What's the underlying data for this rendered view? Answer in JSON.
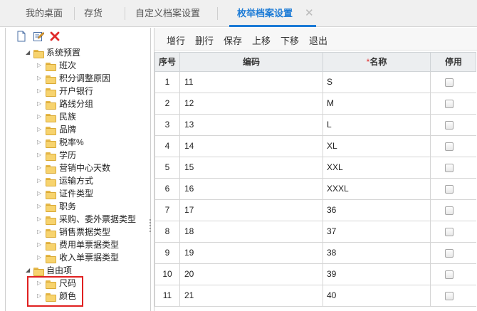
{
  "tabs": [
    {
      "label": "我的桌面",
      "active": false
    },
    {
      "label": "存货",
      "active": false
    },
    {
      "label": "自定义档案设置",
      "active": false
    },
    {
      "label": "枚举档案设置",
      "active": true
    }
  ],
  "left_toolbar": {
    "icons": [
      "new-document-icon",
      "edit-icon",
      "delete-icon"
    ]
  },
  "tree": {
    "system_root": "系统预置",
    "system_items": [
      "班次",
      "积分调整原因",
      "开户银行",
      "路线分组",
      "民族",
      "品牌",
      "税率%",
      "学历",
      "营销中心天数",
      "运输方式",
      "证件类型",
      "职务",
      "采购、委外票据类型",
      "销售票据类型",
      "费用单票据类型",
      "收入单票据类型"
    ],
    "custom_root": "自由项",
    "custom_items": [
      "尺码",
      "颜色"
    ]
  },
  "toolbar": {
    "buttons": [
      "增行",
      "删行",
      "保存",
      "上移",
      "下移",
      "退出"
    ]
  },
  "grid": {
    "headers": {
      "seq": "序号",
      "code": "编码",
      "required_mark": "*",
      "name": "名称",
      "disabled": "停用"
    },
    "rows": [
      {
        "seq": "1",
        "code": "11",
        "name": "S",
        "disabled": false
      },
      {
        "seq": "2",
        "code": "12",
        "name": "M",
        "disabled": false
      },
      {
        "seq": "3",
        "code": "13",
        "name": "L",
        "disabled": false
      },
      {
        "seq": "4",
        "code": "14",
        "name": "XL",
        "disabled": false
      },
      {
        "seq": "5",
        "code": "15",
        "name": "XXL",
        "disabled": false
      },
      {
        "seq": "6",
        "code": "16",
        "name": "XXXL",
        "disabled": false
      },
      {
        "seq": "7",
        "code": "17",
        "name": "36",
        "disabled": false
      },
      {
        "seq": "8",
        "code": "18",
        "name": "37",
        "disabled": false
      },
      {
        "seq": "9",
        "code": "19",
        "name": "38",
        "disabled": false
      },
      {
        "seq": "10",
        "code": "20",
        "name": "39",
        "disabled": false
      },
      {
        "seq": "11",
        "code": "21",
        "name": "40",
        "disabled": false
      }
    ]
  },
  "colors": {
    "accent": "#1a7ad6",
    "highlight": "#e02020",
    "folder": "#f7d36e"
  }
}
